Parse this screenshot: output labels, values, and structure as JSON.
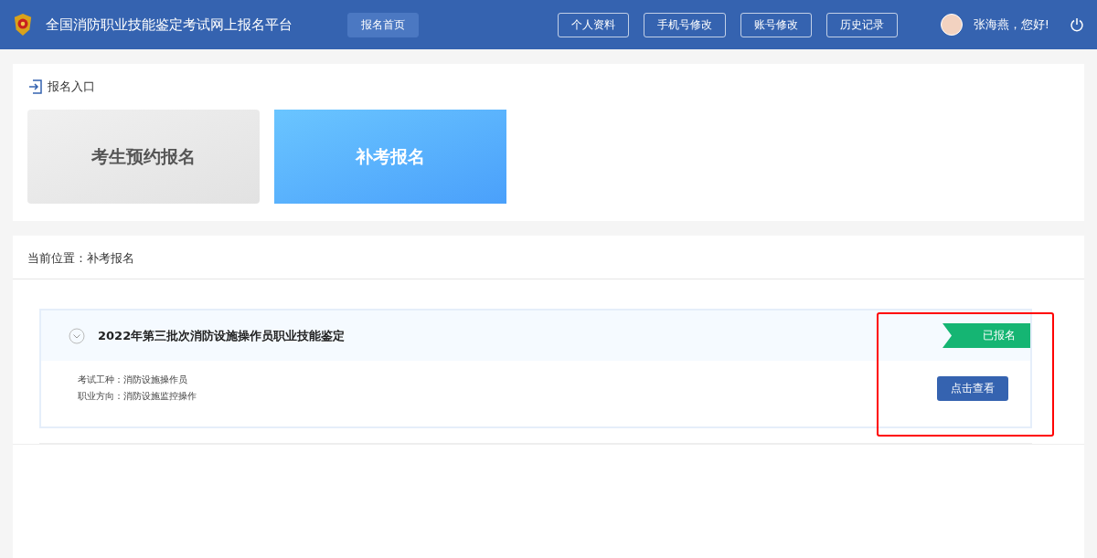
{
  "header": {
    "title": "全国消防职业技能鉴定考试网上报名平台",
    "nav": [
      {
        "label": "报名首页",
        "selected": true
      },
      {
        "label": "个人资料",
        "selected": false
      },
      {
        "label": "手机号修改",
        "selected": false
      },
      {
        "label": "账号修改",
        "selected": false
      },
      {
        "label": "历史记录",
        "selected": false
      }
    ],
    "greeting": "张海燕，您好!"
  },
  "entry": {
    "heading": "报名入口",
    "cards": [
      {
        "label": "考生预约报名",
        "selected": false
      },
      {
        "label": "补考报名",
        "selected": true
      }
    ]
  },
  "breadcrumb": "当前位置：补考报名",
  "exams": [
    {
      "title": "2022年第三批次消防设施操作员职业技能鉴定",
      "status": "已报名",
      "details": [
        "考试工种：消防设施操作员",
        "职业方向：消防设施监控操作"
      ],
      "button": "点击查看",
      "highlighted": true
    }
  ]
}
